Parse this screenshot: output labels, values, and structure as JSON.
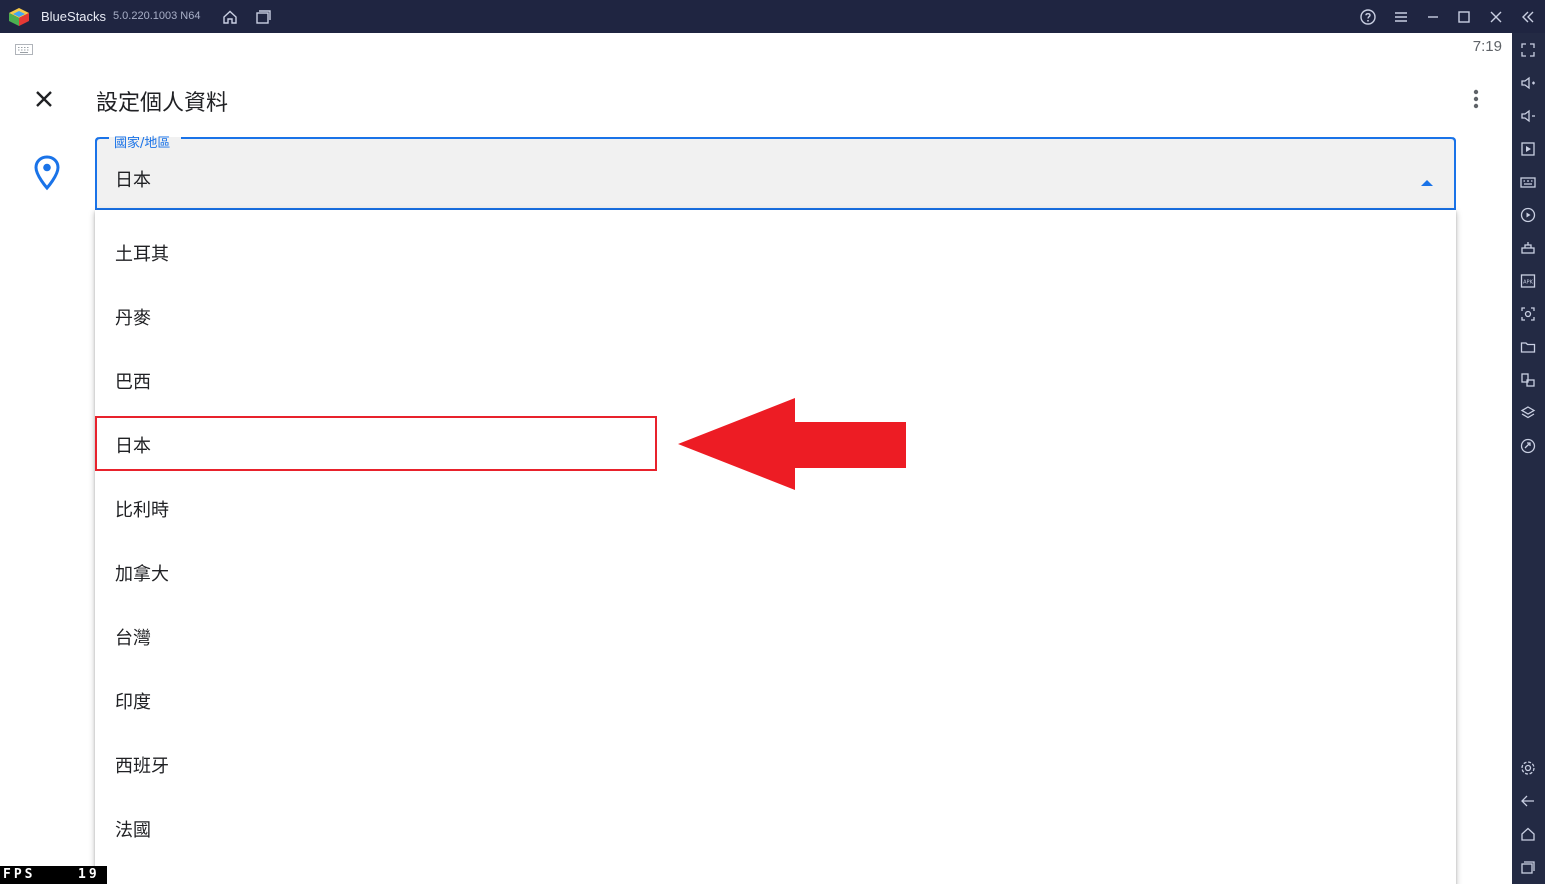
{
  "window": {
    "app_name": "BlueStacks",
    "version": "5.0.220.1003 N64",
    "icons": [
      "bluestacks-logo-icon",
      "home-icon",
      "multi-instance-icon",
      "help-icon",
      "menu-icon",
      "minimize-icon",
      "maximize-icon",
      "close-icon",
      "collapse-sidebar-icon"
    ]
  },
  "status_bar": {
    "time": "7:19"
  },
  "app_bar": {
    "title": "設定個人資料"
  },
  "country_field": {
    "label": "國家/地區",
    "value": "日本"
  },
  "dropdown": {
    "options": [
      "土耳其",
      "丹麥",
      "巴西",
      "日本",
      "比利時",
      "加拿大",
      "台灣",
      "印度",
      "西班牙",
      "法國"
    ],
    "highlighted_option": "日本"
  },
  "fps": {
    "label": "FPS",
    "value": "19"
  },
  "colors": {
    "accent": "#1a73e8",
    "highlight_red": "#e8222c",
    "titlebar": "#1f2541"
  }
}
